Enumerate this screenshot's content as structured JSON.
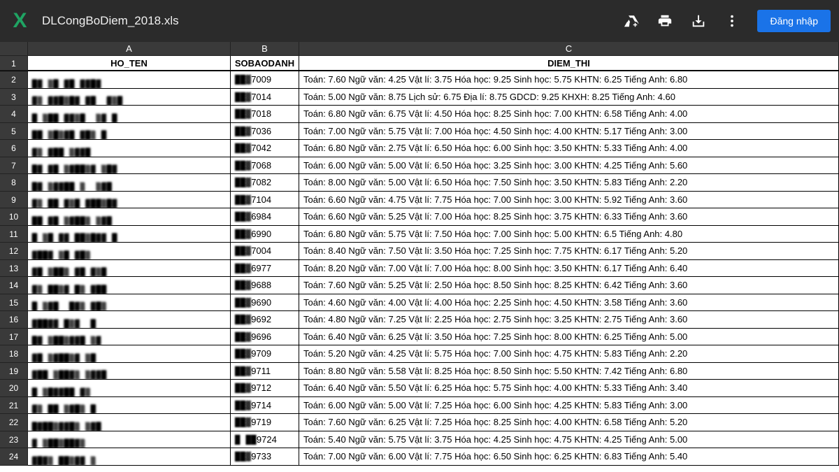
{
  "topbar": {
    "filename": "DLCongBoDiem_2018.xls",
    "signin_label": "Đăng nhập"
  },
  "columns": {
    "letters": [
      "A",
      "B",
      "C"
    ],
    "headers": [
      "HO_TEN",
      "SOBAODANH",
      "DIEM_THI"
    ]
  },
  "rows": [
    {
      "n": 2,
      "name": "█▓ ▒█ ▓█ ▓▓█▓",
      "sbd_blur": "██▓",
      "sbd_tail": "7009",
      "diem": "Toán:   7.60   Ngữ văn:   4.25   Vật lí:   3.75   Hóa học:   9.25   Sinh học:   5.75   KHTN: 6.25   Tiếng Anh:   6.80"
    },
    {
      "n": 3,
      "name": "▓▒ ▓▓█▒█▓ ▓█  ▓▒█",
      "sbd_blur": "██▓",
      "sbd_tail": "7014",
      "diem": "Toán:   5.00   Ngữ văn:   8.75   Lịch sử:   6.75   Địa lí:   8.75   GDCD:   9.25   KHXH: 8.25   Tiếng Anh:   4.60"
    },
    {
      "n": 4,
      "name": "█ ▒██ ▓▓▒█  ▒▓ █",
      "sbd_blur": "██▓",
      "sbd_tail": "7018",
      "diem": "Toán:   6.80   Ngữ văn:   6.75   Vật lí:   4.50   Hóa học:   8.25   Sinh học:   7.00   KHTN: 6.58   Tiếng Anh:   4.00"
    },
    {
      "n": 5,
      "name": "██ ▒█▒▓█ ▓█▒ █",
      "sbd_blur": "██▓",
      "sbd_tail": "7036",
      "diem": "Toán:   7.00   Ngữ văn:   5.75   Vật lí:   7.00   Hóa học:   4.50   Sinh học:   4.00   KHTN: 5.17   Tiếng Anh:   3.00"
    },
    {
      "n": 6,
      "name": "▓▒ ▓██ ▒▓▓█ ",
      "sbd_blur": "██▓",
      "sbd_tail": "7042",
      "diem": "Toán:   6.80   Ngữ văn:   2.75   Vật lí:   6.50   Hóa học:   6.00   Sinh học:   3.50   KHTN: 5.33   Tiếng Anh:   4.00"
    },
    {
      "n": 7,
      "name": "█▓ ▓█ ▒▓██▒▓ ▒█▓",
      "sbd_blur": "██▓",
      "sbd_tail": "7068",
      "diem": "Toán:   6.00   Ngữ văn:   5.00   Vật lí:   6.50   Hóa học:   3.25   Sinh học:   3.00   KHTN: 4.25   Tiếng Anh:   5.60"
    },
    {
      "n": 8,
      "name": "█▓ ▒▓▓██ ▒  ▒▓█",
      "sbd_blur": "██▓",
      "sbd_tail": "7082",
      "diem": "Toán:   8.00   Ngữ văn:   5.00   Vật lí:   6.50   Hóa học:   7.50   Sinh học:   3.50   KHTN: 5.83   Tiếng Anh:   2.20"
    },
    {
      "n": 9,
      "name": "▓▒ ██ ▓▒█ ▓██▒█▓",
      "sbd_blur": "██▓",
      "sbd_tail": "7104",
      "diem": "Toán:   6.60   Ngữ văn:   4.75   Vật lí:   7.75   Hóa học:   7.00   Sinh học:   3.00   KHTN: 5.92   Tiếng Anh:   3.60"
    },
    {
      "n": 10,
      "name": "██ ▓█ ▒▓██▒ ▒▓█",
      "sbd_blur": "██▓",
      "sbd_tail": "6984",
      "diem": "Toán:   6.60   Ngữ văn:   5.25   Vật lí:   7.00   Hóa học:   8.25   Sinh học:   3.75   KHTN: 6.33   Tiếng Anh:   3.60"
    },
    {
      "n": 11,
      "name": "█ ▒█ ▓▓ ██▒█▓▓ █",
      "sbd_blur": "██▓",
      "sbd_tail": "6990",
      "diem": "Toán:   6.80   Ngữ văn:   5.75   Vật lí:   7.50   Hóa học:   7.00   Sinh học:   5.00   KHTN: 6.5   Tiếng Anh:   4.80"
    },
    {
      "n": 12,
      "name": "▓██▓ ▒█ ▓█▒",
      "sbd_blur": "██▓",
      "sbd_tail": "7004",
      "diem": "Toán:   8.40   Ngữ văn:   7.50   Vật lí:   3.50   Hóa học:   7.25   Sinh học:   7.75   KHTN: 6.17   Tiếng Anh:   5.20"
    },
    {
      "n": 13,
      "name": "▓█ ▒██▒ ▓█ ▓▒█",
      "sbd_blur": "██▓",
      "sbd_tail": "6977",
      "diem": "Toán:   8.20   Ngữ văn:   7.00   Vật lí:   7.00   Hóa học:   8.00   Sinh học:   3.50   KHTN: 6.17   Tiếng Anh:   6.40"
    },
    {
      "n": 14,
      "name": "▓▒ ██▒▓ █▒ ▓██",
      "sbd_blur": "██▓",
      "sbd_tail": "9688",
      "diem": "Toán:   7.60   Ngữ văn:   5.25   Vật lí:   2.50   Hóa học:   8.50   Sinh học:   8.25   KHTN: 6.42   Tiếng Anh:   3.60"
    },
    {
      "n": 15,
      "name": "█ ▒▓█  █▓▒ ▓█▒",
      "sbd_blur": "██▓",
      "sbd_tail": "9690",
      "diem": "Toán:   4.60   Ngữ văn:   4.00   Vật lí:   4.00   Hóa học:   2.25   Sinh học:   4.50   KHTN: 3.58   Tiếng Anh:   3.60"
    },
    {
      "n": 16,
      "name": "▓██▓▓ █▒▓  █",
      "sbd_blur": "██▓",
      "sbd_tail": "9692",
      "diem": "Toán:   4.80   Ngữ văn:   7.25   Vật lí:   2.25   Hóa học:   2.75   Sinh học:   3.25   KHTN: 2.75   Tiếng Anh:   3.60"
    },
    {
      "n": 17,
      "name": "█▓ ▒██▒▓▓█ ▒▓",
      "sbd_blur": "██▓",
      "sbd_tail": "9696",
      "diem": "Toán:   6.40   Ngữ văn:   6.25   Vật lí:   3.50   Hóa học:   7.25   Sinh học:   8.00   KHTN: 6.25   Tiếng Anh:   5.00"
    },
    {
      "n": 18,
      "name": "▓█ ▒▓██▒▓ ▒█",
      "sbd_blur": "██▓",
      "sbd_tail": "9709",
      "diem": "Toán:   5.20   Ngữ văn:   4.25   Vật lí:   5.75   Hóa học:   7.00   Sinh học:   4.75   KHTN: 5.83   Tiếng Anh:   2.20"
    },
    {
      "n": 19,
      "name": "▓██ ▒██▓▒ ▒▓▓█",
      "sbd_blur": "██▓",
      "sbd_tail": "9711",
      "diem": "Toán:   8.80   Ngữ văn:   5.58   Vật lí:   8.25   Hóa học:   8.50   Sinh học:   5.50   KHTN: 7.42   Tiếng Anh:   6.80"
    },
    {
      "n": 20,
      "name": "█ ▒█▓▓██ ▓▒",
      "sbd_blur": "██▓",
      "sbd_tail": "9712",
      "diem": "Toán:   6.40   Ngữ văn:   5.50   Vật lí:   6.25   Hóa học:   5.75   Sinh học:   4.00   KHTN: 5.33   Tiếng Anh:   3.40"
    },
    {
      "n": 21,
      "name": "▓▒ ██ ▒▓█▒ █",
      "sbd_blur": "██▓",
      "sbd_tail": "9714",
      "diem": "Toán:   6.00   Ngữ văn:   5.00   Vật lí:   7.25   Hóa học:   6.00   Sinh học:   4.25   KHTN: 5.83   Tiếng Anh:   3.00"
    },
    {
      "n": 22,
      "name": "█▓██▒▓▓█▒ ▒▓█",
      "sbd_blur": "██▓",
      "sbd_tail": "9719",
      "diem": "Toán:   7.60   Ngữ văn:   6.25   Vật lí:   7.25   Hóa học:   8.25   Sinh học:   4.00   KHTN: 6.58   Tiếng Anh:   5.20"
    },
    {
      "n": 23,
      "name": "▓ ▒██▒██▓▒",
      "sbd_blur": "█ ██",
      "sbd_tail": "9724",
      "diem": "Toán:   5.40   Ngữ văn:   5.75   Vật lí:   3.75   Hóa học:   4.25   Sinh học:   4.75   KHTN: 4.25   Tiếng Anh:   5.00"
    },
    {
      "n": 24,
      "name": "▓█▓▒ ██▒▓▓ ▒",
      "sbd_blur": "██▓",
      "sbd_tail": "9733",
      "diem": "Toán:   7.00   Ngữ văn:   6.00   Vật lí:   7.75   Hóa học:   6.50   Sinh học:   6.25   KHTN: 6.83   Tiếng Anh:   5.40"
    }
  ]
}
